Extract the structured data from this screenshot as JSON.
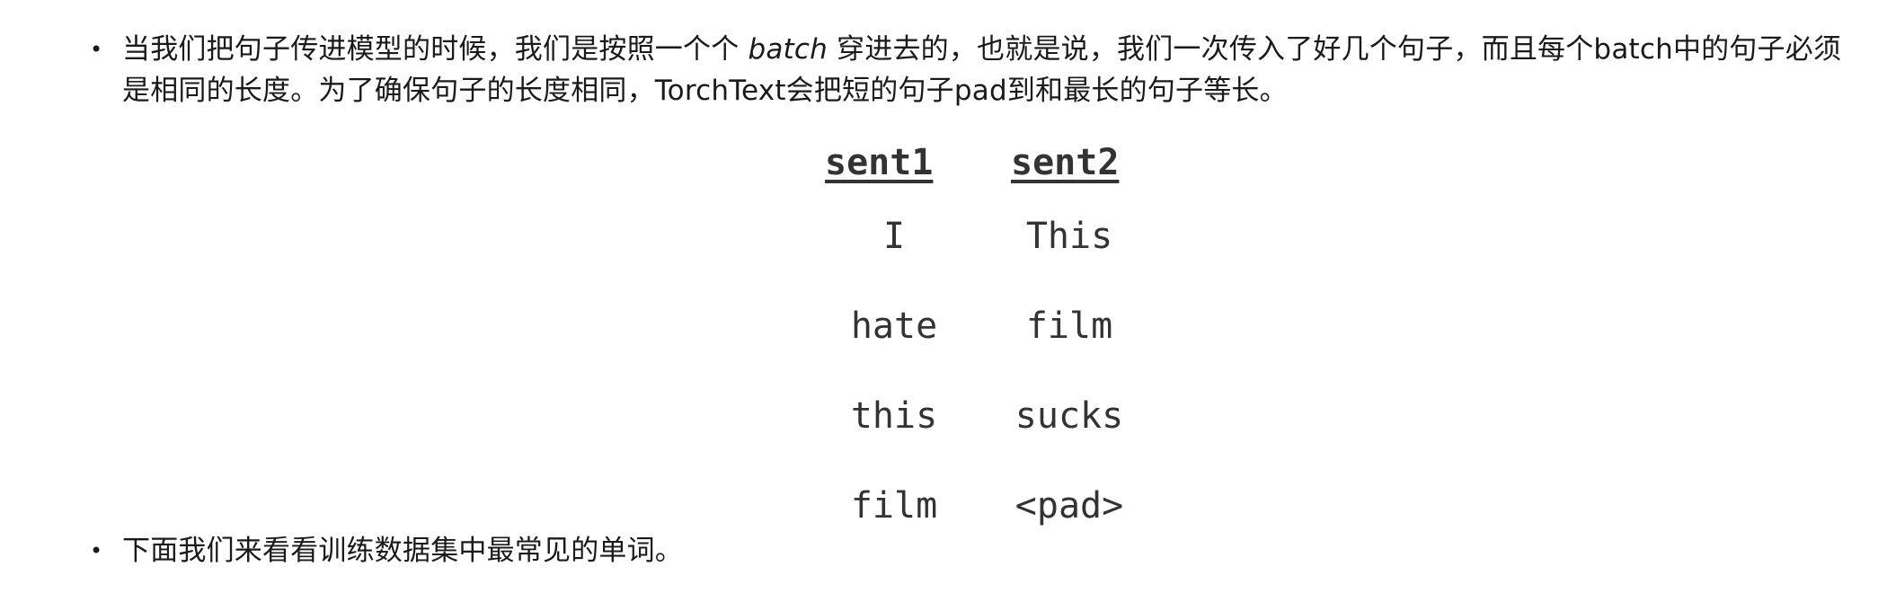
{
  "bullets": [
    {
      "part1": "当我们把句子传进模型的时候，我们是按照一个个 ",
      "italic": "batch",
      "part2": " 穿进去的，也就是说，我们一次传入了好几个句子，而且每个batch中的句子必须是相同的长度。为了确保句子的长度相同，TorchText会把短的句子pad到和最长的句子等长。"
    },
    {
      "text": "下面我们来看看训练数据集中最常见的单词。"
    }
  ],
  "bullet_symbol": "•",
  "table": {
    "headers": [
      "sent1",
      "sent2"
    ],
    "rows": [
      [
        "I",
        "This"
      ],
      [
        "hate",
        "film"
      ],
      [
        "this",
        "sucks"
      ],
      [
        "film",
        "<pad>"
      ]
    ]
  }
}
